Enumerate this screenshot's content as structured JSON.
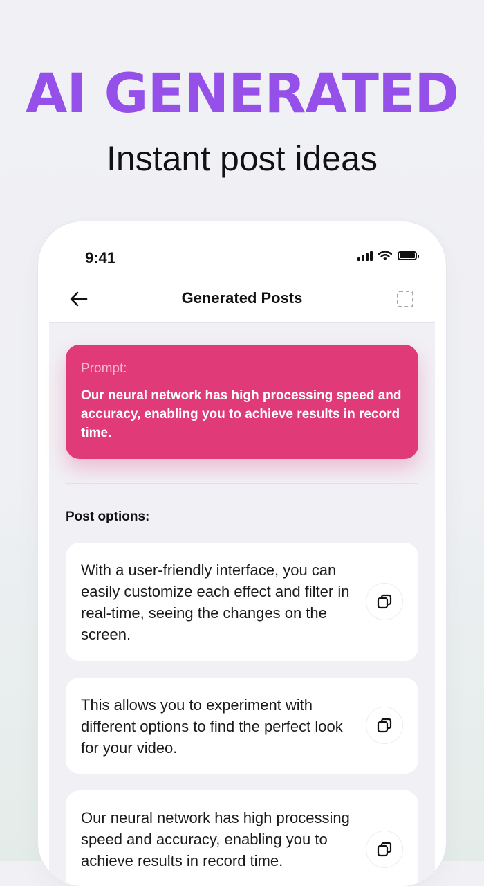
{
  "hero": {
    "title": "AI GENERATED",
    "subtitle": "Instant post ideas"
  },
  "status_bar": {
    "time": "9:41",
    "icons": [
      "signal-icon",
      "wifi-icon",
      "battery-icon"
    ]
  },
  "nav": {
    "title": "Generated Posts",
    "back_icon": "arrow-left-icon",
    "select_icon": "dashed-square-icon"
  },
  "prompt": {
    "label": "Prompt:",
    "text": "Our neural network has high processing speed and accuracy, enabling you to achieve results in record time."
  },
  "options": {
    "label": "Post options:",
    "posts": [
      {
        "text": "With a user-friendly interface, you can easily customize each effect and filter in real-time, seeing the changes on the screen.",
        "action_icon": "copy-icon"
      },
      {
        "text": "This allows you to experiment with different options to find the perfect look for your video.",
        "action_icon": "copy-icon"
      },
      {
        "text": "Our neural network has high processing speed and accuracy, enabling you to achieve results in record time.",
        "action_icon": "copy-icon"
      }
    ]
  },
  "colors": {
    "accent_purple": "#9650ea",
    "prompt_pink": "#e03a78",
    "background": "#f1f1f5"
  }
}
